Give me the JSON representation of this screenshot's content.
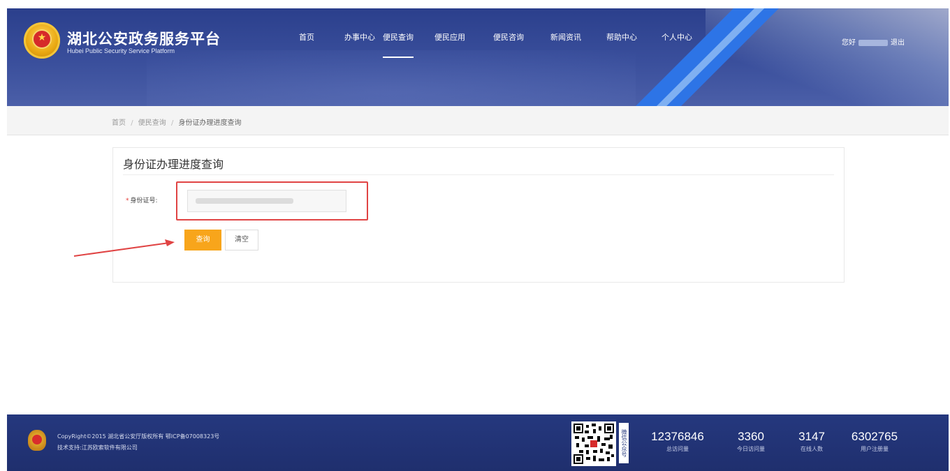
{
  "header": {
    "site_title": "湖北公安政务服务平台",
    "site_subtitle": "Hubei Public Security Service Platform",
    "nav": [
      {
        "label": "首页",
        "active": false
      },
      {
        "label": "办事中心",
        "active": false
      },
      {
        "label": "便民查询",
        "active": true
      },
      {
        "label": "便民应用",
        "active": false
      },
      {
        "label": "便民咨询",
        "active": false
      },
      {
        "label": "新闻资讯",
        "active": false
      },
      {
        "label": "帮助中心",
        "active": false
      },
      {
        "label": "个人中心",
        "active": false
      }
    ],
    "greeting": "您好",
    "logout": "退出"
  },
  "breadcrumb": {
    "home": "首页",
    "sep1": "/",
    "section": "便民查询",
    "sep2": "/",
    "current": "身份证办理进度查询"
  },
  "form": {
    "title": "身份证办理进度查询",
    "required_mark": "*",
    "id_label": "身份证号:",
    "id_value": "",
    "query_button": "查询",
    "clear_button": "清空"
  },
  "footer": {
    "copyright": "CopyRight©2015  湖北省公安厅版权所有  鄂ICP备07008323号",
    "tech_support": "技术支持:江苏欧索软件有限公司",
    "qr_label": "微信公众号",
    "stats": [
      {
        "value": "12376846",
        "label": "总访问量"
      },
      {
        "value": "3360",
        "label": "今日访问量"
      },
      {
        "value": "3147",
        "label": "在线人数"
      },
      {
        "value": "6302765",
        "label": "用户注册量"
      }
    ]
  },
  "colors": {
    "header_bg": "#2b3f8c",
    "accent_blue": "#2d74e6",
    "query_button": "#f8a51b",
    "highlight_red": "#e04444",
    "footer_bg": "#25387e"
  },
  "icons": {
    "logo": "police-emblem-icon",
    "footer_logo": "police-emblem-icon",
    "annotation": "red-arrow-annotation"
  }
}
